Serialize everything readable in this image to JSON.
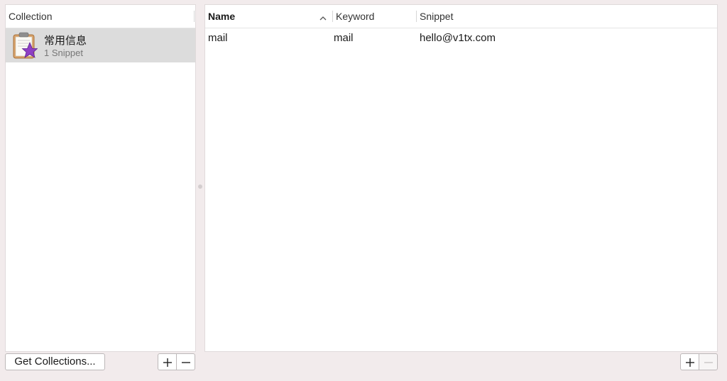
{
  "collections_panel": {
    "header": "Collection",
    "items": [
      {
        "name": "常用信息",
        "count_label": "1 Snippet",
        "icon": "clipboard-star-icon"
      }
    ]
  },
  "snippets_table": {
    "columns": [
      {
        "label": "Name",
        "sorted": "ascending"
      },
      {
        "label": "Keyword"
      },
      {
        "label": "Snippet"
      }
    ],
    "rows": [
      {
        "name": "mail",
        "keyword": "mail",
        "snippet": "hello@v1tx.com"
      }
    ]
  },
  "footer": {
    "get_collections_label": "Get Collections...",
    "add_symbol": "+",
    "remove_symbol": "−"
  },
  "colors": {
    "window_background": "#f2ebec",
    "selected_row": "#dcdcdc",
    "star": "#8e3fc4",
    "clipboard": "#d9a26a"
  }
}
